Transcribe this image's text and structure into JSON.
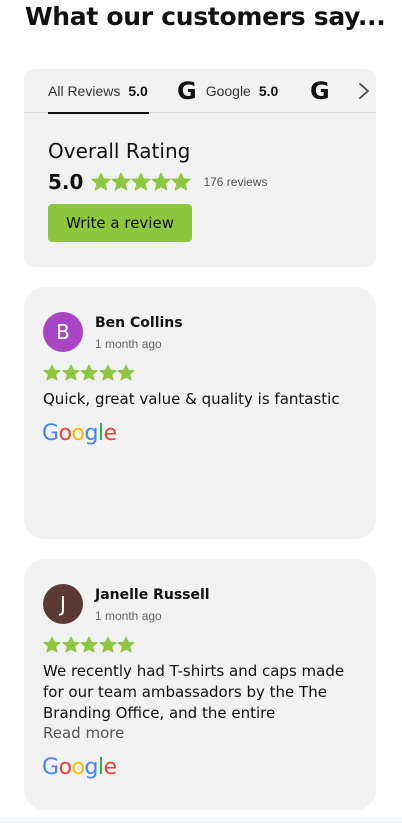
{
  "heading": "What our customers say...",
  "tabs": [
    {
      "label": "All Reviews",
      "score": "5.0"
    },
    {
      "label": "Google",
      "score": "5.0"
    }
  ],
  "google_letter": "G",
  "summary": {
    "title": "Overall Rating",
    "score": "5.0",
    "rating": 5,
    "count": "176 reviews",
    "write_button": "Write a review"
  },
  "reviews": [
    {
      "initial": "B",
      "avatar_color": "#a845c4",
      "name": "Ben Collins",
      "date": "1 month ago",
      "rating": 5,
      "text": "Quick, great value & quality is fantastic"
    },
    {
      "initial": "J",
      "avatar_color": "#5a3a32",
      "name": "Janelle Russell",
      "date": "1 month ago",
      "rating": 5,
      "text": "We recently had T-shirts and caps made for our team ambassadors by the The Branding Office, and the entire experience was nothing",
      "read_more": "Read more"
    }
  ],
  "google_logo": [
    "G",
    "o",
    "o",
    "g",
    "l",
    "e"
  ],
  "colors": {
    "star": "#8dc63f",
    "button": "#8dc63f",
    "card_bg": "#f2f2f2",
    "google_blue": "#4285F4",
    "google_red": "#EA4335",
    "google_yellow": "#FBBC05",
    "google_green": "#34A853"
  },
  "icons": {
    "next": "chevron-right-icon",
    "source": "google-icon"
  }
}
